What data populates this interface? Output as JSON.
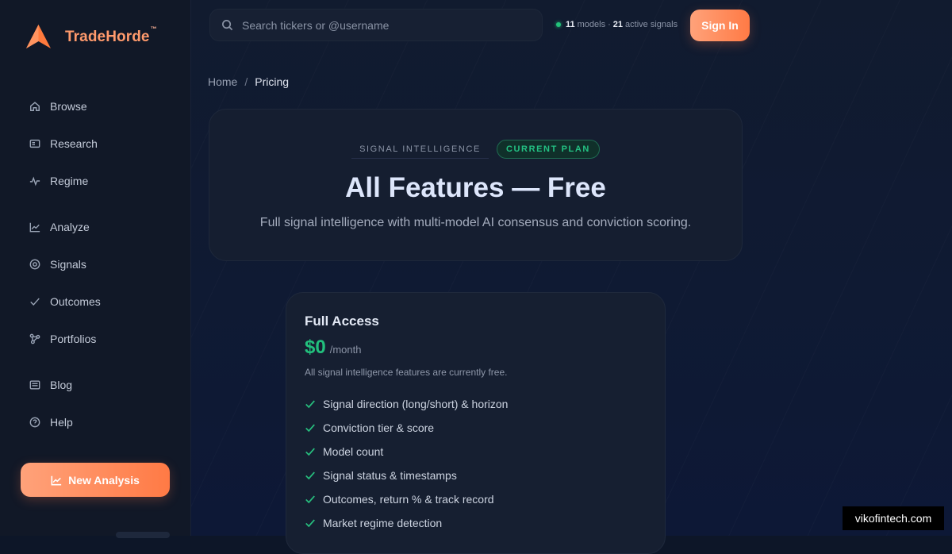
{
  "app": {
    "name": "TradeHorde",
    "tm": "™"
  },
  "sidebar": {
    "items": [
      {
        "label": "Browse",
        "icon": "home-icon"
      },
      {
        "label": "Research",
        "icon": "research-icon"
      },
      {
        "label": "Regime",
        "icon": "pulse-icon"
      },
      {
        "label": "Analyze",
        "icon": "chart-icon"
      },
      {
        "label": "Signals",
        "icon": "target-icon"
      },
      {
        "label": "Outcomes",
        "icon": "check-icon"
      },
      {
        "label": "Portfolios",
        "icon": "network-icon"
      },
      {
        "label": "Blog",
        "icon": "document-icon"
      },
      {
        "label": "Help",
        "icon": "help-icon"
      }
    ],
    "new_analysis_label": "New Analysis"
  },
  "topbar": {
    "search_placeholder": "Search tickers or @username",
    "models_count": "11",
    "models_label": "models",
    "separator": "·",
    "signals_count": "21",
    "signals_label": "active signals",
    "signin_label": "Sign In"
  },
  "breadcrumb": {
    "home": "Home",
    "separator": "/",
    "current": "Pricing"
  },
  "hero": {
    "badge_left": "SIGNAL INTELLIGENCE",
    "badge_right": "CURRENT PLAN",
    "title": "All Features — Free",
    "subtitle": "Full signal intelligence with multi-model AI consensus and conviction scoring."
  },
  "plan": {
    "name": "Full Access",
    "price": "$0",
    "period": "/month",
    "note": "All signal intelligence features are currently free.",
    "features": [
      "Signal direction (long/short) & horizon",
      "Conviction tier & score",
      "Model count",
      "Signal status & timestamps",
      "Outcomes, return % & track record",
      "Market regime detection"
    ]
  },
  "watermark": "vikofintech.com",
  "colors": {
    "accent": "#ff8a5c",
    "success": "#22c07d",
    "background": "#0d1628"
  }
}
